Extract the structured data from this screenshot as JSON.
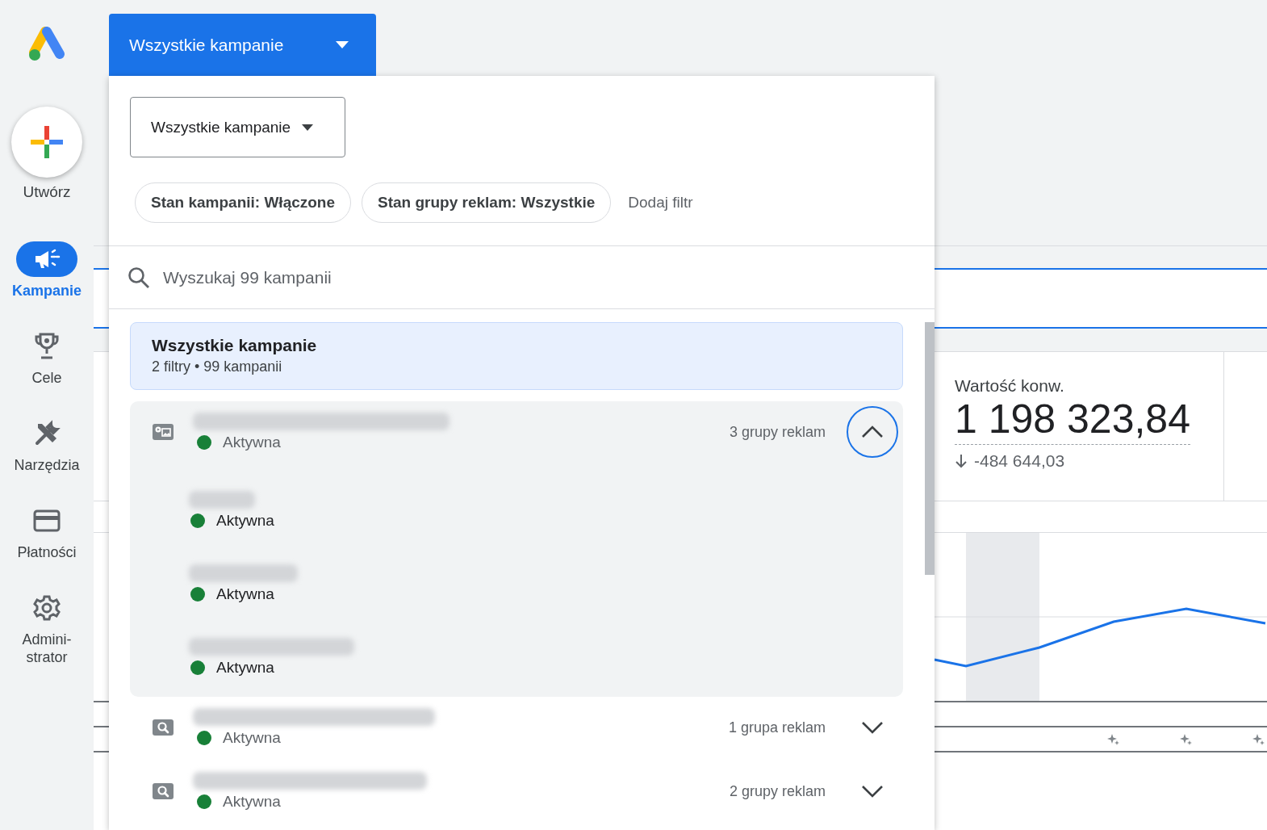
{
  "sidebar": {
    "create_button": {
      "label": "Utwórz"
    },
    "nav_items": [
      {
        "label": "Kampanie",
        "selected": true
      },
      {
        "label": "Cele",
        "selected": false
      },
      {
        "label": "Narzędzia",
        "selected": false
      },
      {
        "label": "Płatności",
        "selected": false
      },
      {
        "label": "Admini-strator",
        "selected": false
      }
    ]
  },
  "campaign_picker": {
    "label": "Wszystkie kampanie"
  },
  "panel": {
    "scope_dropdown": {
      "label": "Wszystkie kampanie"
    },
    "filters": [
      {
        "label": "Stan kampanii: Włączone"
      },
      {
        "label": "Stan grupy reklam: Wszystkie"
      }
    ],
    "add_filter": "Dodaj filtr",
    "search": {
      "placeholder": "Wyszukaj 99 kampanii"
    },
    "all_campaigns": {
      "title": "Wszystkie kampanie",
      "subtitle": "2 filtry • 99 kampanii",
      "selected": true
    },
    "campaigns": [
      {
        "kind": "display",
        "status": "Aktywna",
        "color": "#188038",
        "ad_groups": "3 grupy reklam",
        "expanded": true,
        "children": [
          {
            "status": "Aktywna",
            "color": "#188038"
          },
          {
            "status": "Aktywna",
            "color": "#188038"
          },
          {
            "status": "Aktywna",
            "color": "#188038"
          }
        ]
      },
      {
        "kind": "search",
        "status": "Aktywna",
        "color": "#188038",
        "ad_groups": "1 grupa reklam",
        "expanded": false
      },
      {
        "kind": "search",
        "status": "Aktywna",
        "color": "#188038",
        "ad_groups": "2 grupy reklam",
        "expanded": false
      }
    ]
  },
  "stat": {
    "label": "Wartość konw.",
    "value": "1 198 323,84",
    "change": "-484 644,03"
  }
}
